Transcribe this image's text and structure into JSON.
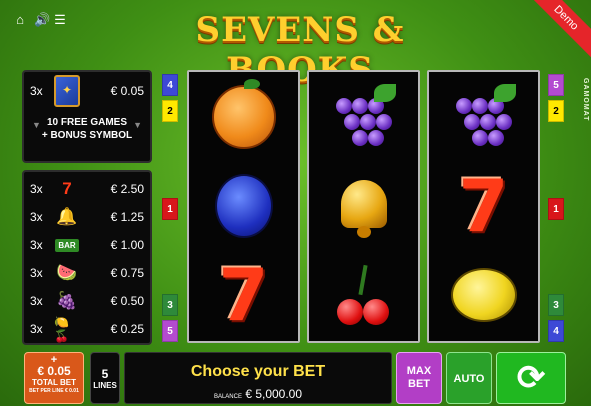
{
  "game": {
    "title": "SEVENS & BOOKS",
    "demo_label": "Demo",
    "vendor": "GAMOMAT"
  },
  "top_icons": [
    "home-icon",
    "sound-icon",
    "menu-icon"
  ],
  "bonus": {
    "mult": "3x",
    "value": "€ 0.05",
    "line1": "10 FREE GAMES",
    "line2": "+ BONUS SYMBOL"
  },
  "paytable": [
    {
      "mult": "3x",
      "symbol": "seven",
      "value": "€ 2.50"
    },
    {
      "mult": "3x",
      "symbol": "bell",
      "value": "€ 1.25"
    },
    {
      "mult": "3x",
      "symbol": "bar",
      "value": "€ 1.00"
    },
    {
      "mult": "3x",
      "symbol": "watermelon",
      "value": "€ 0.75"
    },
    {
      "mult": "3x",
      "symbol": "grapes",
      "value": "€ 0.50"
    },
    {
      "mult": "3x",
      "symbol": "mixed-fruit",
      "value": "€ 0.25"
    }
  ],
  "bar_label": "BAR",
  "line_markers": {
    "left": [
      "4",
      "2",
      "1",
      "3",
      "5"
    ],
    "right": [
      "5",
      "2",
      "1",
      "3",
      "4"
    ]
  },
  "reels": [
    [
      "orange",
      "plum",
      "seven"
    ],
    [
      "grapes",
      "bell",
      "cherries"
    ],
    [
      "grapes",
      "seven",
      "lemon"
    ]
  ],
  "controls": {
    "total_plus": "+",
    "total_amount": "€ 0.05",
    "total_label": "TOTAL BET",
    "total_sub": "BET PER LINE € 0.01",
    "lines_count": "5",
    "lines_label": "LINES",
    "message": "Choose your BET",
    "balance_label": "BALANCE",
    "balance_value": "€ 5,000.00",
    "maxbet_line1": "MAX",
    "maxbet_line2": "BET",
    "auto_label": "AUTO"
  },
  "colors": {
    "marker_blue": "#3d49d6",
    "marker_yellow": "#ffe900",
    "marker_red": "#d8161b",
    "marker_green": "#2e8a3a",
    "marker_purple": "#b34bd0"
  }
}
